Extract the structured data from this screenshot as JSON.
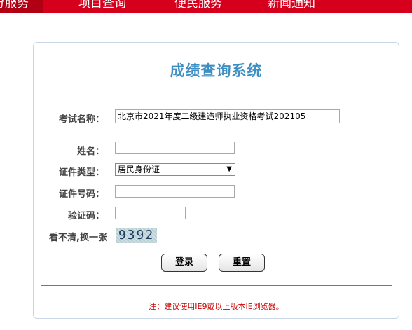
{
  "nav": {
    "items": [
      {
        "label": "分服务",
        "active": true
      },
      {
        "label": "项目查询"
      },
      {
        "label": "便民服务"
      },
      {
        "label": "新闻通知"
      }
    ]
  },
  "form": {
    "title": "成绩查询系统",
    "exam_name_label": "考试名称：",
    "exam_name_value": "北京市2021年度二级建造师执业资格考试202105",
    "name_label": "姓名：",
    "name_value": "",
    "id_type_label": "证件类型：",
    "id_type_value": "居民身份证",
    "id_number_label": "证件号码：",
    "id_number_value": "",
    "captcha_label": "验证码：",
    "captcha_value": "",
    "refresh_label": "看不清,换一张",
    "captcha_text": "9392",
    "login_label": "登录",
    "reset_label": "重置",
    "note": "注：建议使用IE9或以上版本IE浏览器。"
  },
  "colors": {
    "brand_red": "#d6001c",
    "title_blue": "#3d8ec3",
    "note_red": "#cc0000"
  }
}
